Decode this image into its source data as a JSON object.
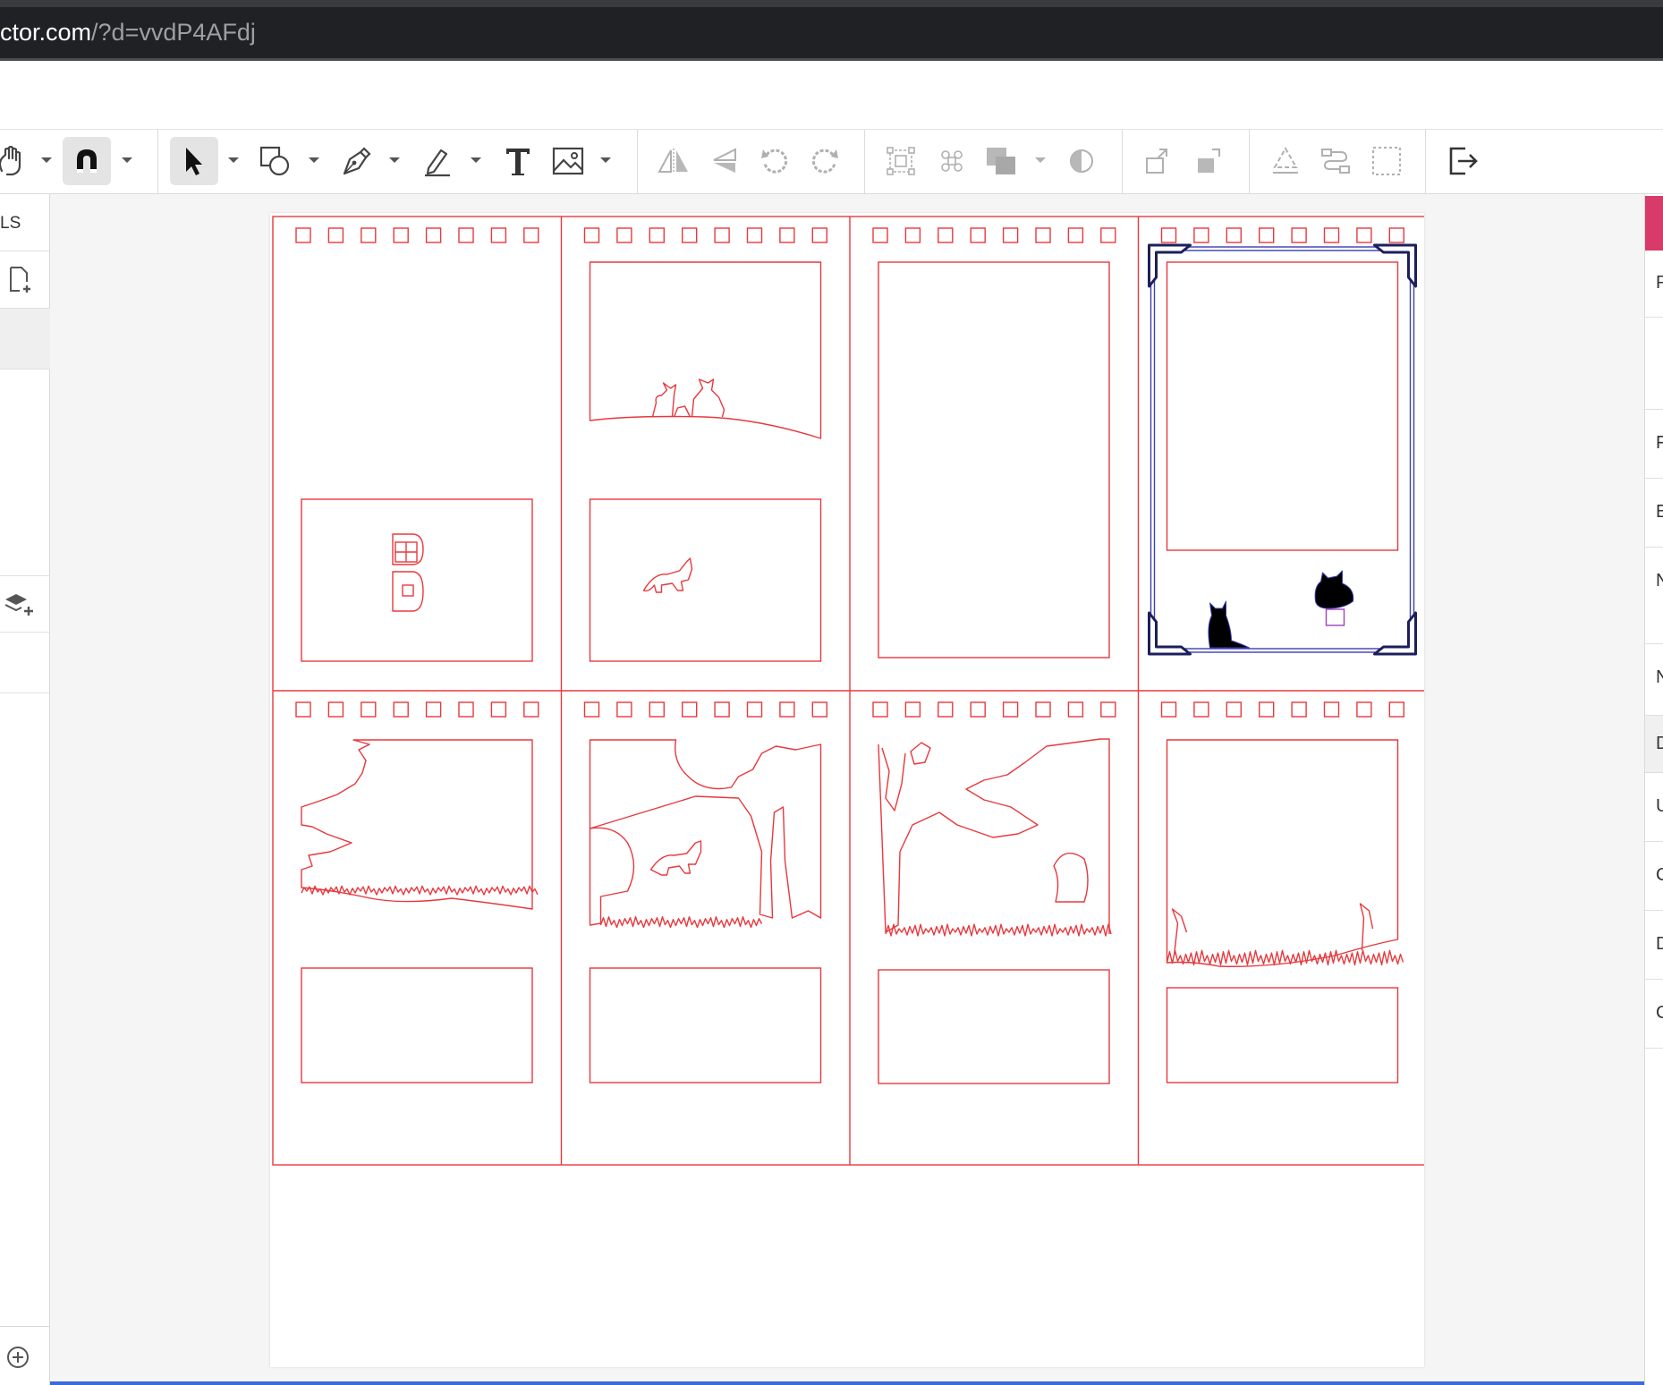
{
  "browser": {
    "url_host": "ctor.com",
    "url_path": "/?d=vvdP4AFdj"
  },
  "colors": {
    "cut_line": "#e8383d",
    "selection": "#3b3fb0",
    "accent": "#d83a6a",
    "icon": "#555555"
  },
  "left_panel": {
    "label": "LS"
  },
  "right_panel": {
    "letters": [
      "P",
      "F",
      "E",
      "N",
      "N",
      "D",
      "U",
      "C",
      "D",
      "C"
    ]
  },
  "toolbar": {
    "icons": [
      "hand-icon",
      "magnet-icon",
      "select-arrow-icon",
      "shape-icon",
      "pen-icon",
      "pencil-icon",
      "text-icon",
      "image-icon",
      "flip-horizontal-icon",
      "flip-vertical-icon",
      "rotate-left-icon",
      "rotate-right-icon",
      "group-icon",
      "ungroup-icon",
      "boolean-union-icon",
      "boolean-intersect-icon",
      "move-up-icon",
      "move-down-icon",
      "recycle-icon",
      "path-icon",
      "bounding-box-icon",
      "export-icon"
    ]
  },
  "design": {
    "columns": 4,
    "rows": 2,
    "selected_panel": 3
  }
}
